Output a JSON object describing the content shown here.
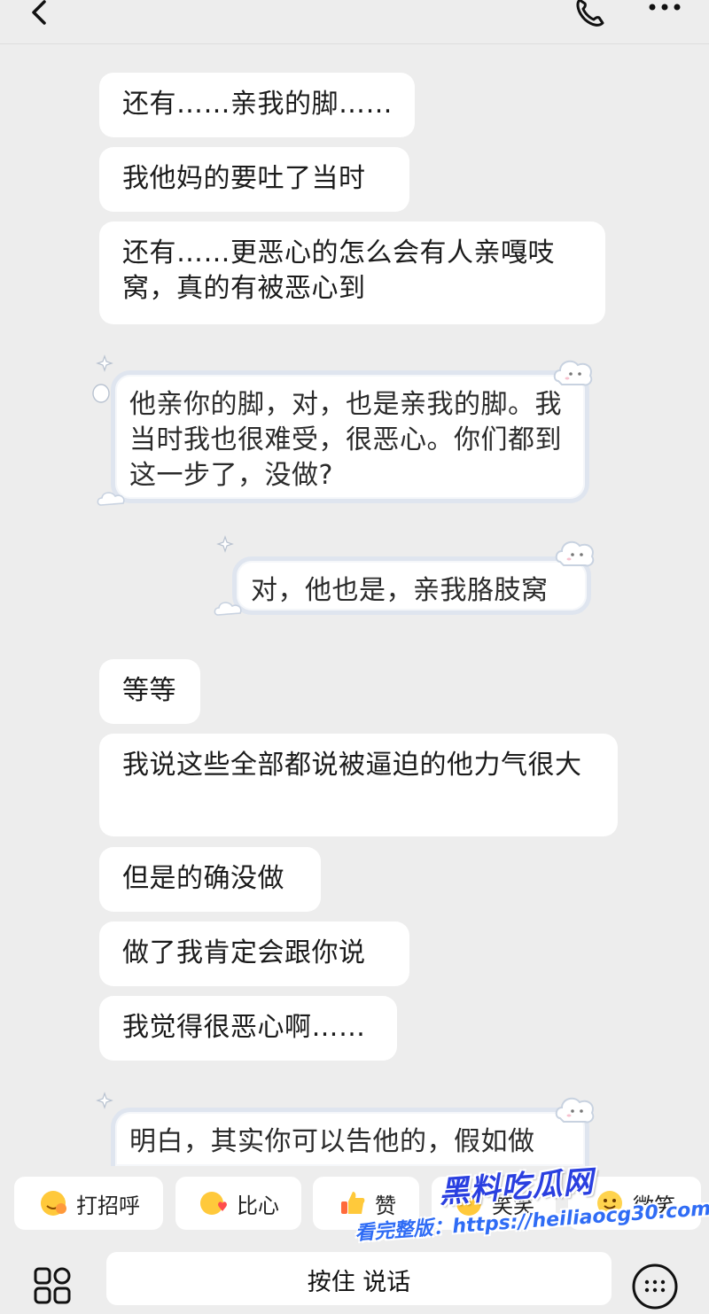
{
  "messages": {
    "received": [
      "还有……亲我的脚……",
      "我他妈的要吐了当时",
      "还有……更恶心的怎么会有人亲嘎吱窝，真的有被恶心到",
      "等等",
      "我说这些全部都说被逼迫的他力气很大",
      "但是的确没做",
      "做了我肯定会跟你说",
      "我觉得很恶心啊……"
    ],
    "sent": [
      "他亲你的脚，对，也是亲我的脚。我当时我也很难受，很恶心。你们都到这一步了，没做?",
      "对，他也是，亲我胳肢窝",
      "明白，其实你可以告他的，假如做"
    ]
  },
  "quick_replies": [
    {
      "label": "打招呼",
      "icon": "wave-emoji-icon"
    },
    {
      "label": "比心",
      "icon": "heart-hands-emoji-icon"
    },
    {
      "label": "赞",
      "icon": "thumbs-up-emoji-icon"
    },
    {
      "label": "笑笑",
      "icon": "laugh-emoji-icon"
    },
    {
      "label": "微笑",
      "icon": "smile-emoji-icon"
    }
  ],
  "input": {
    "hold_to_talk": "按住 说话"
  },
  "watermark": {
    "title": "黑料吃瓜网",
    "url": "看完整版：https://heiliaocg30.com"
  },
  "colors": {
    "background": "#ededed",
    "bubble": "#ffffff",
    "sent_border": "#dfe5ef",
    "watermark": "#2a3fe0"
  }
}
